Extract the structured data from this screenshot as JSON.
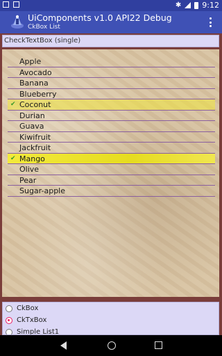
{
  "status_bar": {
    "time": "9:12",
    "icons": [
      "notification-icon",
      "sim-icon",
      "bluetooth-icon",
      "signal-icon",
      "battery-icon"
    ]
  },
  "app_bar": {
    "title": "UiComponents v1.0 API22 Debug",
    "subtitle": "CkBox List"
  },
  "section_header": "CheckTextBox (single)",
  "list_items": [
    {
      "label": "Apple",
      "checked": false
    },
    {
      "label": "Avocado",
      "checked": false
    },
    {
      "label": "Banana",
      "checked": false
    },
    {
      "label": "Blueberry",
      "checked": false
    },
    {
      "label": "Coconut",
      "checked": true
    },
    {
      "label": "Durian",
      "checked": false
    },
    {
      "label": "Guava",
      "checked": false
    },
    {
      "label": "Kiwifruit",
      "checked": false
    },
    {
      "label": "Jackfruit",
      "checked": false
    },
    {
      "label": "Mango",
      "checked": true
    },
    {
      "label": "Olive",
      "checked": false
    },
    {
      "label": "Pear",
      "checked": false
    },
    {
      "label": "Sugar-apple",
      "checked": false
    }
  ],
  "radio_options": [
    {
      "label": "CkBox",
      "selected": false
    },
    {
      "label": "CkTxBox",
      "selected": true
    },
    {
      "label": "Simple List1",
      "selected": false
    }
  ],
  "colors": {
    "app_bar": "#3f51b5",
    "status_bar": "#303f9f",
    "selection": "#e6dc1f",
    "radio_accent": "#e91e63"
  }
}
